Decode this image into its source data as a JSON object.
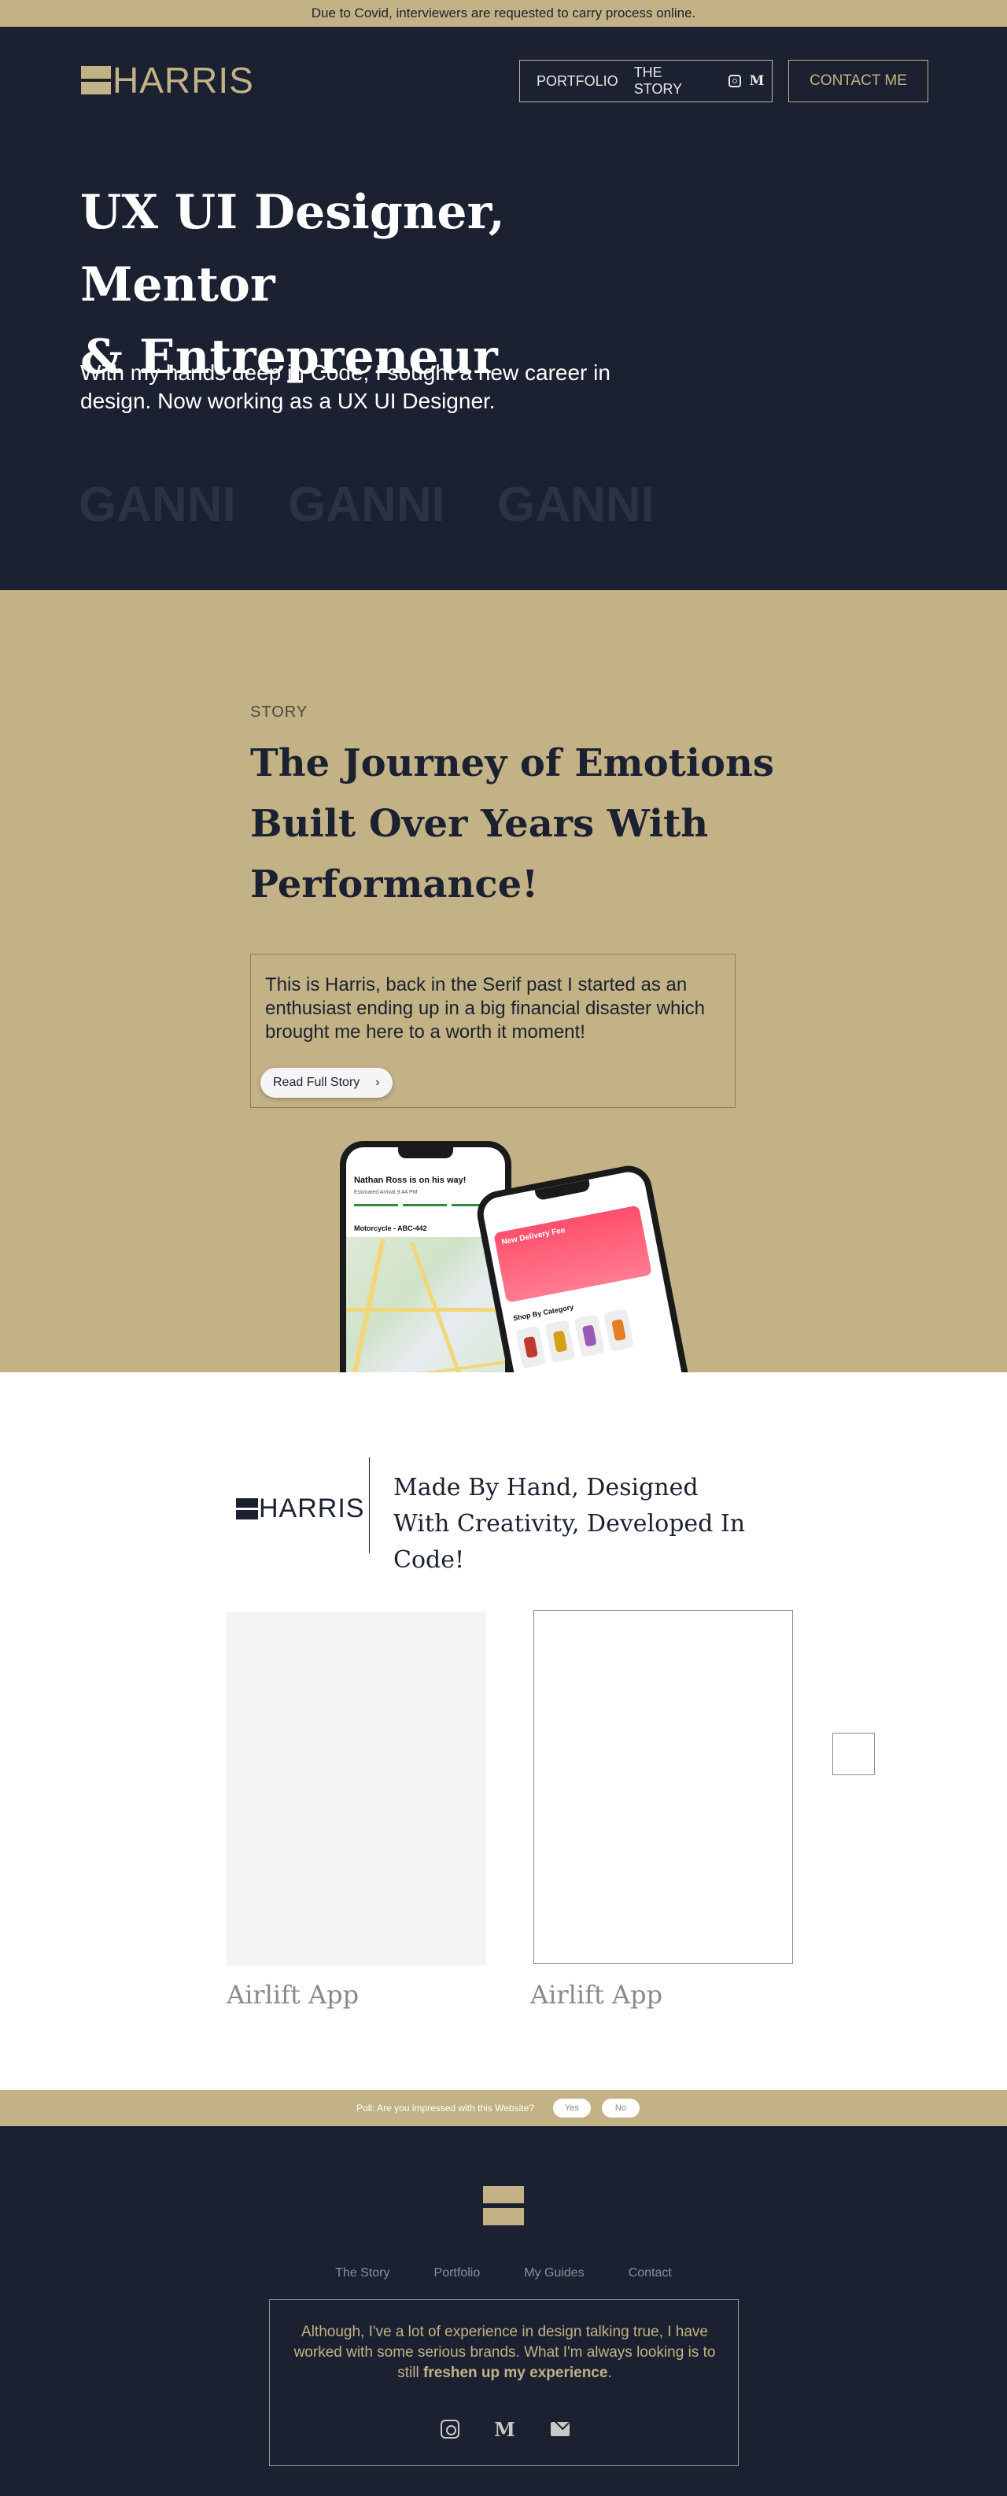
{
  "banner": {
    "text": "Due to Covid, interviewers are requested to carry process online."
  },
  "header": {
    "logo_text": "HARRIS",
    "nav": [
      {
        "label": "PORTFOLIO"
      },
      {
        "label": "THE STORY"
      }
    ],
    "social_icons": [
      "instagram-icon",
      "medium-icon"
    ],
    "medium_glyph": "M",
    "contact_label": "CONTACT ME"
  },
  "hero": {
    "title_line1": "UX UI Designer, Mentor",
    "title_line2": "& Entrepreneur",
    "subtitle": "With my hands deep in Code, I sought a new career in design. Now working as a UX UI Designer.",
    "brands": [
      "GANNI",
      "GANNI",
      "GANNI"
    ]
  },
  "story": {
    "label": "STORY",
    "title": "The Journey of Emotions Built Over Years With Performance!",
    "text": "This is Harris, back in the Serif past I started as an enthusiast ending up in a big financial disaster which brought me here to a worth it moment!",
    "button_label": "Read Full Story",
    "button_icon": "chevron-right-icon",
    "phone1": {
      "title": "Nathan Ross is on his way!",
      "subtitle": "Estimated Arrival 9:44 PM",
      "ride": "Motorcycle - ABC-442"
    },
    "phone2": {
      "header": "New Delivery Fee",
      "category": "Shop By Category"
    }
  },
  "work": {
    "logo_text": "HARRIS",
    "tagline": "Made By Hand, Designed With Creativity, Developed In Code!",
    "cards": [
      {
        "label": "Airlift App"
      },
      {
        "label": "Airlift App"
      }
    ]
  },
  "poll": {
    "question": "Poll: Are you impressed with this Website?",
    "yes": "Yes",
    "no": "No"
  },
  "footer": {
    "nav": [
      "The Story",
      "Portfolio",
      "My Guides",
      "Contact"
    ],
    "text_main": "Although, I've a lot of experience in design talking true, I have worked with some serious brands. What I'm always looking is to still ",
    "text_bold": "freshen up my experience",
    "text_end": ".",
    "icons": [
      "instagram-icon",
      "medium-icon",
      "mail-icon"
    ],
    "medium_glyph": "M"
  },
  "colors": {
    "navy": "#1b2130",
    "gold": "#c2b285",
    "white": "#ffffff"
  }
}
